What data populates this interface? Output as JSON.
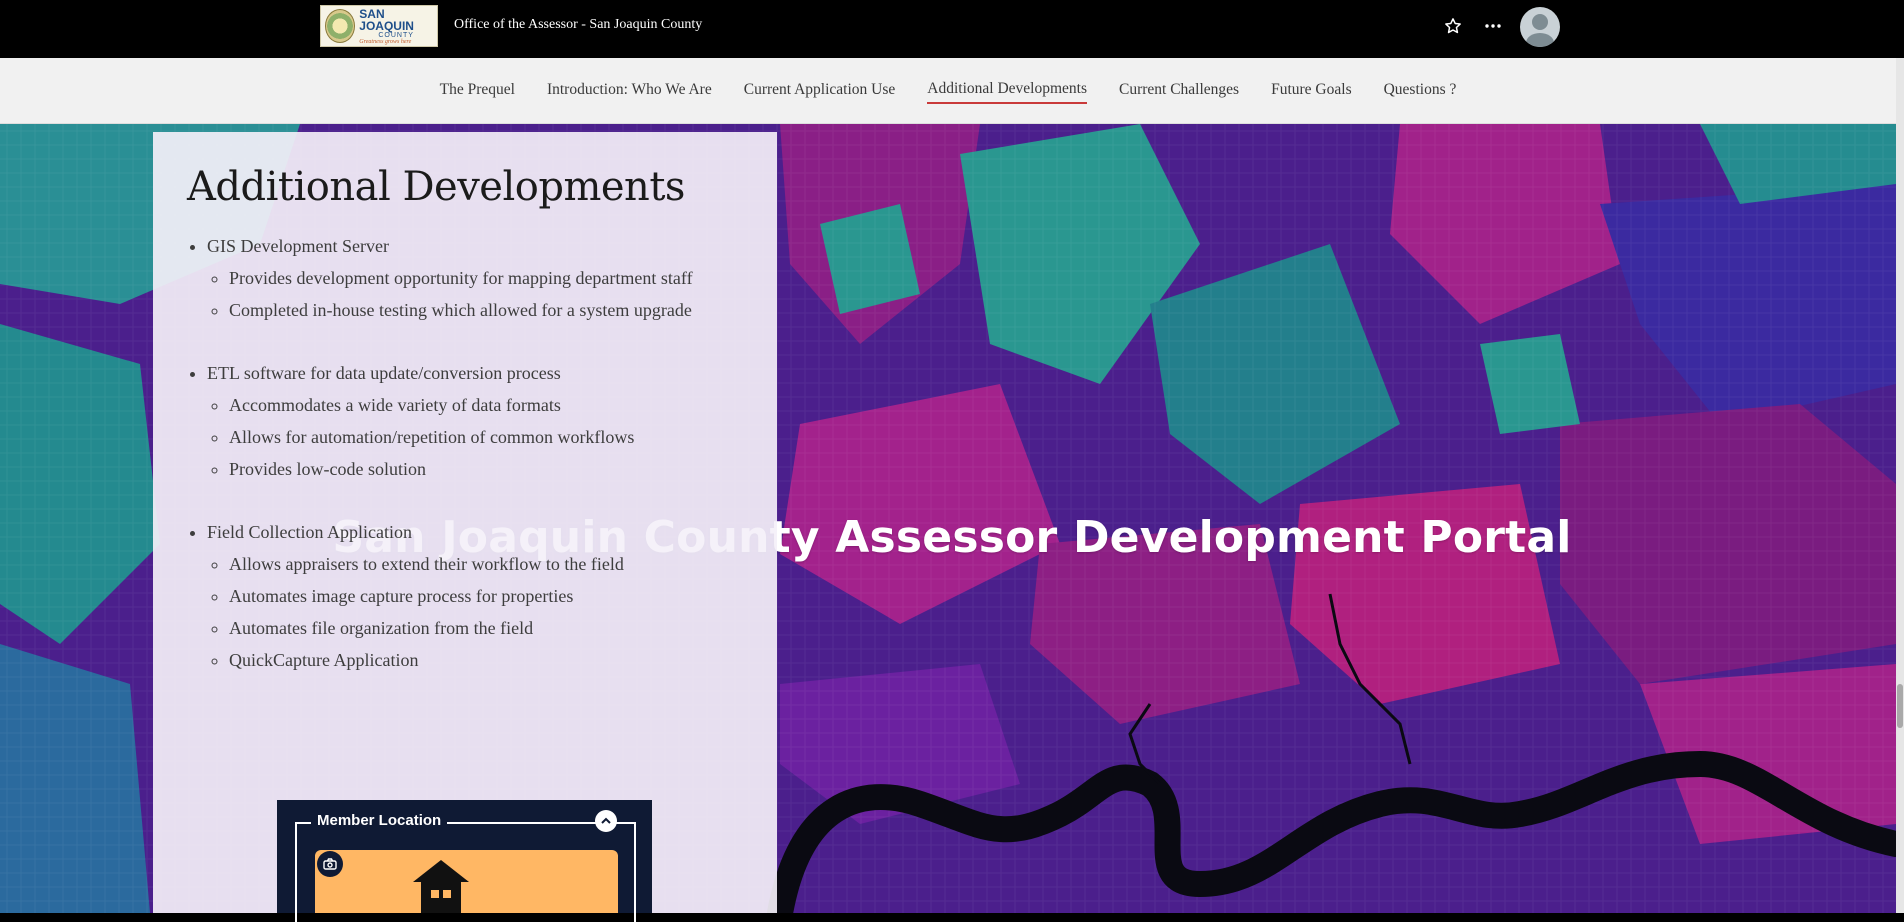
{
  "header": {
    "logo": {
      "main": "SAN JOAQUIN",
      "sub": "COUNTY",
      "tagline": "Greatness grows here"
    },
    "site_title": "Office of the Assessor - San Joaquin County"
  },
  "nav": {
    "items": [
      "The Prequel",
      "Introduction: Who We Are",
      "Current Application Use",
      "Additional Developments",
      "Current Challenges",
      "Future Goals",
      "Questions ?"
    ],
    "active": "Additional Developments"
  },
  "map": {
    "title": "San Joaquin County Assessor Development Portal"
  },
  "panel": {
    "heading": "Additional Developments",
    "sections": [
      {
        "title": "GIS Development Server",
        "items": [
          "Provides development opportunity for mapping department staff",
          "Completed in-house testing which allowed for a system upgrade"
        ]
      },
      {
        "title": "ETL software for data update/conversion process",
        "items": [
          "Accommodates a wide variety of data formats",
          "Allows for automation/repetition of common workflows",
          "Provides low-code solution"
        ]
      },
      {
        "title": "Field Collection Application",
        "items": [
          "Allows appraisers to extend their workflow to the field",
          "Automates image capture process for properties",
          "Automates file organization from the field",
          "QuickCapture Application"
        ]
      }
    ]
  },
  "widget": {
    "label": "Member Location"
  },
  "colors": {
    "accent": "#c93a3a",
    "map_base": "#4b1f8c",
    "map_magenta": "#b0207f",
    "map_teal": "#1f9e93",
    "widget_body": "#ffb764"
  }
}
